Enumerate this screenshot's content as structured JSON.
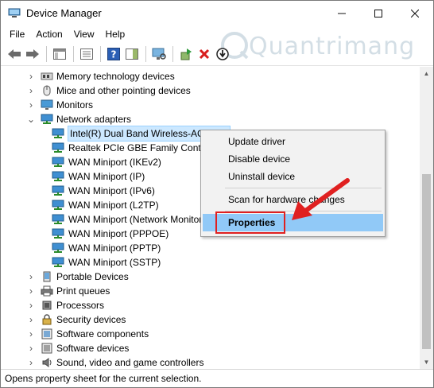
{
  "window": {
    "title": "Device Manager",
    "minimize": "—",
    "maximize": "☐",
    "close": "✕"
  },
  "menu": [
    "File",
    "Action",
    "View",
    "Help"
  ],
  "toolbar": [
    {
      "icon": "back-arrow-icon"
    },
    {
      "icon": "forward-arrow-icon"
    },
    {
      "sep": true
    },
    {
      "icon": "show-hide-console-tree-icon"
    },
    {
      "sep": true
    },
    {
      "icon": "properties-sheet-icon"
    },
    {
      "sep": true
    },
    {
      "icon": "help-icon"
    },
    {
      "icon": "action-pane-icon"
    },
    {
      "sep": true
    },
    {
      "icon": "scan-hardware-icon"
    },
    {
      "sep": true
    },
    {
      "icon": "update-driver-icon"
    },
    {
      "icon": "uninstall-device-icon"
    },
    {
      "icon": "download-driver-icon"
    }
  ],
  "tree": {
    "top_items": [
      {
        "label": "Memory technology devices",
        "icon": "memory-device-icon",
        "expanded": false
      },
      {
        "label": "Mice and other pointing devices",
        "icon": "mouse-icon",
        "expanded": false
      },
      {
        "label": "Monitors",
        "icon": "monitor-icon",
        "expanded": false
      },
      {
        "label": "Network adapters",
        "icon": "network-adapter-icon",
        "expanded": true
      }
    ],
    "network_children": [
      "Intel(R) Dual Band Wireless-AC 3160",
      "Realtek PCIe GBE Family Controller",
      "WAN Miniport (IKEv2)",
      "WAN Miniport (IP)",
      "WAN Miniport (IPv6)",
      "WAN Miniport (L2TP)",
      "WAN Miniport (Network Monitor)",
      "WAN Miniport (PPPOE)",
      "WAN Miniport (PPTP)",
      "WAN Miniport (SSTP)"
    ],
    "bottom_items": [
      {
        "label": "Portable Devices",
        "icon": "portable-device-icon"
      },
      {
        "label": "Print queues",
        "icon": "printer-icon"
      },
      {
        "label": "Processors",
        "icon": "processor-icon"
      },
      {
        "label": "Security devices",
        "icon": "security-device-icon"
      },
      {
        "label": "Software components",
        "icon": "software-component-icon"
      },
      {
        "label": "Software devices",
        "icon": "software-device-icon"
      },
      {
        "label": "Sound, video and game controllers",
        "icon": "sound-icon"
      }
    ]
  },
  "context_menu": {
    "items": [
      "Update driver",
      "Disable device",
      "Uninstall device",
      "Scan for hardware changes",
      "Properties"
    ]
  },
  "statusbar": {
    "text": "Opens property sheet for the current selection."
  },
  "watermark": {
    "text": "Quantrimang"
  },
  "colors": {
    "highlight": "#91c9f7",
    "annotation_red": "#e02020",
    "selection": "#cce8ff"
  }
}
